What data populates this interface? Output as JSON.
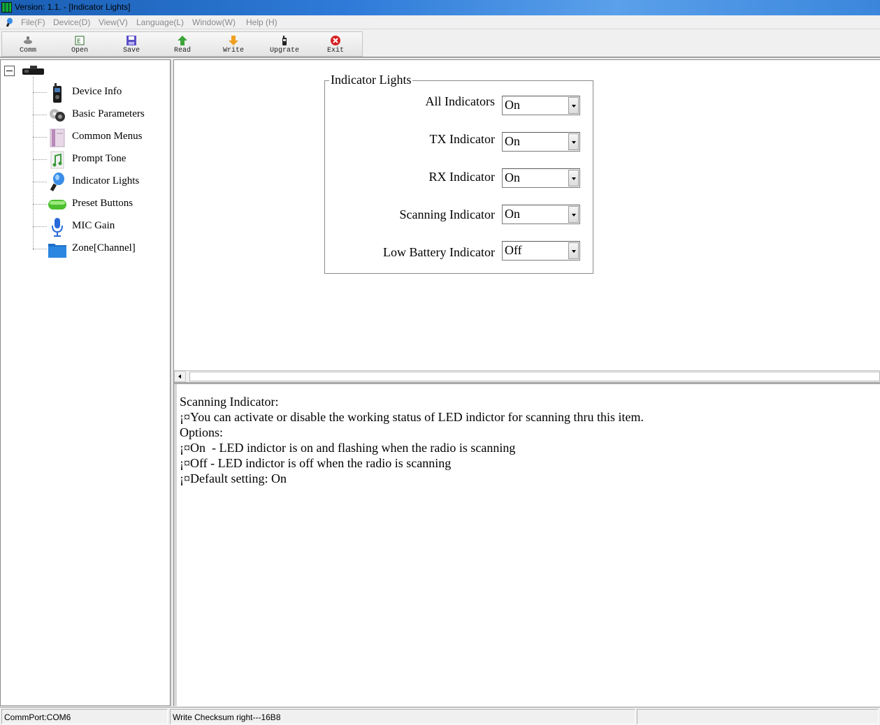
{
  "window": {
    "title": "Version: 1.1. - [Indicator Lights]"
  },
  "menu": {
    "items": [
      "File(F)",
      "Device(D)",
      "View(V)",
      "Language(L)",
      "Window(W)",
      "Help (H)"
    ]
  },
  "toolbar": {
    "buttons": [
      {
        "label": "Comm",
        "icon": "comm-icon"
      },
      {
        "label": "Open",
        "icon": "open-icon"
      },
      {
        "label": "Save",
        "icon": "save-icon"
      },
      {
        "label": "Read",
        "icon": "read-arrow-up-icon"
      },
      {
        "label": "Write",
        "icon": "write-arrow-down-icon"
      },
      {
        "label": "Upgrate",
        "icon": "upgrade-radio-icon"
      },
      {
        "label": "Exit",
        "icon": "exit-icon"
      }
    ]
  },
  "tree": {
    "root_icon": "radio-device-icon",
    "items": [
      {
        "label": "Device Info",
        "icon": "handheld-radio-icon"
      },
      {
        "label": "Basic Parameters",
        "icon": "gear-icon"
      },
      {
        "label": "Common Menus",
        "icon": "book-icon"
      },
      {
        "label": "Prompt Tone",
        "icon": "music-note-icon"
      },
      {
        "label": "Indicator Lights",
        "icon": "light-bulb-icon"
      },
      {
        "label": "Preset Buttons",
        "icon": "green-button-icon"
      },
      {
        "label": "MIC Gain",
        "icon": "microphone-icon"
      },
      {
        "label": "Zone[Channel]",
        "icon": "folder-icon"
      }
    ]
  },
  "indicator_lights": {
    "group_title": "Indicator Lights",
    "rows": [
      {
        "label": "All Indicators",
        "value": "On"
      },
      {
        "label": "TX Indicator",
        "value": "On"
      },
      {
        "label": "RX Indicator",
        "value": "On"
      },
      {
        "label": "Scanning Indicator",
        "value": "On"
      },
      {
        "label": "Low Battery Indicator",
        "value": "Off"
      }
    ]
  },
  "description": {
    "lines": [
      "Scanning Indicator:",
      "¡¤You can activate or disable the working status of LED indictor for scanning thru this item.",
      "Options:",
      "¡¤On  - LED indictor is on and flashing when the radio is scanning",
      "¡¤Off - LED indictor is off when the radio is scanning",
      "¡¤Default setting: On"
    ]
  },
  "status": {
    "port": "CommPort:COM6",
    "message": "Write Checksum right---16B8",
    "extra": ""
  }
}
